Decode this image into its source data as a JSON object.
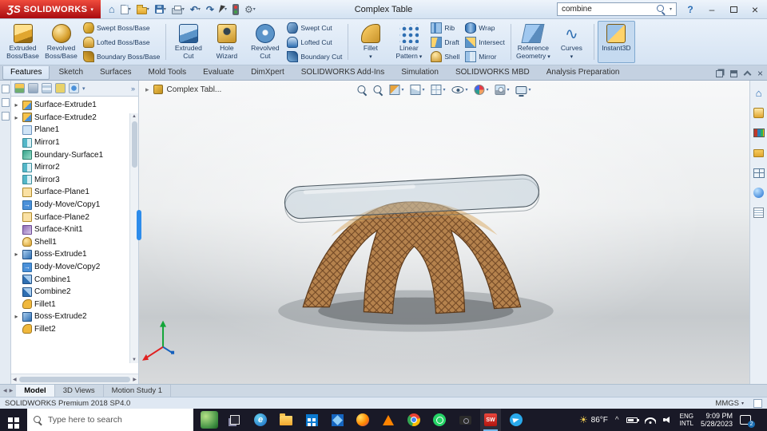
{
  "colors": {
    "logo_red": "#c9151b",
    "titlebar_bg": "#d9e6f5",
    "ribbon_bg": "#dbe7f4",
    "taskbar_bg": "#191927",
    "accent_blue": "#2d8ceb",
    "wood_brown": "#b5824d",
    "active_app_underline": "#76b9ed"
  },
  "titlebar": {
    "logo_mark": "ƷS",
    "logo_text": "SOLIDWORKS",
    "title": "Complex Table",
    "search_value": "combine",
    "tools": [
      "home-icon",
      "new-document-icon",
      "open-document-icon",
      "save-icon",
      "print-icon",
      "undo-icon",
      "redo-icon",
      "select-cursor-icon",
      "rebuild-icon",
      "options-gear-icon"
    ],
    "search_icon": "search-icon",
    "window_controls": [
      "help",
      "minimize",
      "maximize",
      "close"
    ]
  },
  "ribbon": {
    "groups": [
      {
        "large": [
          {
            "l1": "Extruded",
            "l2": "Boss/Base",
            "icon": "extruded-boss-icon"
          },
          {
            "l1": "Revolved",
            "l2": "Boss/Base",
            "icon": "revolved-boss-icon"
          }
        ],
        "small": [
          {
            "label": "Swept Boss/Base",
            "icon": "swept-boss-icon"
          },
          {
            "label": "Lofted Boss/Base",
            "icon": "lofted-boss-icon"
          },
          {
            "label": "Boundary Boss/Base",
            "icon": "boundary-boss-icon"
          }
        ]
      },
      {
        "large": [
          {
            "l1": "Extruded",
            "l2": "Cut",
            "icon": "extruded-cut-icon"
          },
          {
            "l1": "Hole",
            "l2": "Wizard",
            "icon": "hole-wizard-icon"
          },
          {
            "l1": "Revolved",
            "l2": "Cut",
            "icon": "revolved-cut-icon"
          }
        ],
        "small": [
          {
            "label": "Swept Cut",
            "icon": "swept-cut-icon"
          },
          {
            "label": "Lofted Cut",
            "icon": "lofted-cut-icon"
          },
          {
            "label": "Boundary Cut",
            "icon": "boundary-cut-icon"
          }
        ]
      },
      {
        "large": [
          {
            "l1": "Fillet",
            "l2": "",
            "icon": "fillet-icon"
          },
          {
            "l1": "Linear",
            "l2": "Pattern",
            "icon": "linear-pattern-icon"
          }
        ],
        "small": [
          {
            "label": "Rib",
            "icon": "rib-icon"
          },
          {
            "label": "Draft",
            "icon": "draft-icon"
          },
          {
            "label": "Shell",
            "icon": "shell-icon"
          }
        ],
        "small2": [
          {
            "label": "Wrap",
            "icon": "wrap-icon"
          },
          {
            "label": "Intersect",
            "icon": "intersect-icon"
          },
          {
            "label": "Mirror",
            "icon": "mirror-icon"
          }
        ]
      },
      {
        "large": [
          {
            "l1": "Reference",
            "l2": "Geometry",
            "icon": "reference-geometry-icon"
          },
          {
            "l1": "Curves",
            "l2": "",
            "icon": "curves-icon"
          }
        ]
      },
      {
        "large": [
          {
            "l1": "Instant3D",
            "l2": "",
            "icon": "instant3d-icon",
            "active": true
          }
        ]
      }
    ]
  },
  "command_tabs": {
    "active": "Features",
    "items": [
      "Features",
      "Sketch",
      "Surfaces",
      "Mold Tools",
      "Evaluate",
      "DimXpert",
      "SOLIDWORKS Add-Ins",
      "Simulation",
      "SOLIDWORKS MBD",
      "Analysis Preparation"
    ],
    "pane_controls": [
      "pane-restore-icon",
      "pane-expand-icon",
      "collapse-ribbon-icon",
      "close-pane-icon"
    ]
  },
  "left_rail_icons": [
    "collapsed-panel-icon-1",
    "collapsed-panel-icon-2",
    "collapsed-panel-icon-3"
  ],
  "feature_tree": {
    "header_icons": [
      "featuremanager-icon",
      "propertymanager-icon",
      "configurationmanager-icon",
      "dimxpertmanager-icon",
      "displaymanager-icon"
    ],
    "items": [
      {
        "label": "Surface-Extrude1",
        "icon": "surface-extrude-feature-icon",
        "exp": true
      },
      {
        "label": "Surface-Extrude2",
        "icon": "surface-extrude-feature-icon",
        "exp": true
      },
      {
        "label": "Plane1",
        "icon": "plane-feature-icon"
      },
      {
        "label": "Mirror1",
        "icon": "mirror-feature-icon"
      },
      {
        "label": "Boundary-Surface1",
        "icon": "boundary-surface-feature-icon"
      },
      {
        "label": "Mirror2",
        "icon": "mirror-feature-icon"
      },
      {
        "label": "Mirror3",
        "icon": "mirror-feature-icon"
      },
      {
        "label": "Surface-Plane1",
        "icon": "surface-plane-feature-icon"
      },
      {
        "label": "Body-Move/Copy1",
        "icon": "body-move-feature-icon"
      },
      {
        "label": "Surface-Plane2",
        "icon": "surface-plane-feature-icon"
      },
      {
        "label": "Surface-Knit1",
        "icon": "surface-knit-feature-icon"
      },
      {
        "label": "Shell1",
        "icon": "shell-feature-icon"
      },
      {
        "label": "Boss-Extrude1",
        "icon": "boss-extrude-feature-icon",
        "exp": true
      },
      {
        "label": "Body-Move/Copy2",
        "icon": "body-move-feature-icon"
      },
      {
        "label": "Combine1",
        "icon": "combine-feature-icon"
      },
      {
        "label": "Combine2",
        "icon": "combine-feature-icon"
      },
      {
        "label": "Fillet1",
        "icon": "fillet-feature-icon"
      },
      {
        "label": "Boss-Extrude2",
        "icon": "boss-extrude-feature-icon",
        "exp": true
      },
      {
        "label": "Fillet2",
        "icon": "fillet-feature-icon"
      }
    ]
  },
  "viewport": {
    "breadcrumb": "Complex Tabl...",
    "hud_icons": [
      "zoom-fit-icon",
      "zoom-area-icon",
      "section-view-icon",
      "view-orientation-icon",
      "display-style-icon",
      "hide-show-items-icon",
      "edit-appearance-icon",
      "apply-scene-icon",
      "view-settings-icon"
    ],
    "model": "complex-table-3d-model",
    "triad_axes": [
      "x-red",
      "y-green",
      "z-blue"
    ]
  },
  "task_pane_icons": [
    "home-tab-icon",
    "resources-icon",
    "design-library-icon",
    "file-explorer-tab-icon",
    "view-palette-icon",
    "appearances-icon",
    "custom-properties-icon"
  ],
  "model_tabs": {
    "active": "Model",
    "items": [
      "Model",
      "3D Views",
      "Motion Study 1"
    ]
  },
  "statusbar": {
    "product": "SOLIDWORKS Premium 2018 SP4.0",
    "units": "MMGS"
  },
  "taskbar": {
    "search_placeholder": "Type here to search",
    "leaf_icon": "news-leaf-icon",
    "task_view_icon": "task-view-icon",
    "app_icons": [
      "edge-icon",
      "file-explorer-icon",
      "microsoft-store-icon",
      "photos-icon",
      "firefox-icon",
      "vlc-icon",
      "chrome-icon",
      "whatsapp-icon",
      "camera-icon",
      "solidworks-app-icon",
      "telegram-icon"
    ],
    "active_app": "solidworks-app-icon",
    "tray": {
      "temperature": "86°F",
      "tray_icons": [
        "battery-icon",
        "network-icon",
        "volume-icon"
      ],
      "language_line1": "ENG",
      "language_line2": "INTL",
      "time": "9:09 PM",
      "date": "5/28/2023",
      "notification_count": "2"
    }
  }
}
